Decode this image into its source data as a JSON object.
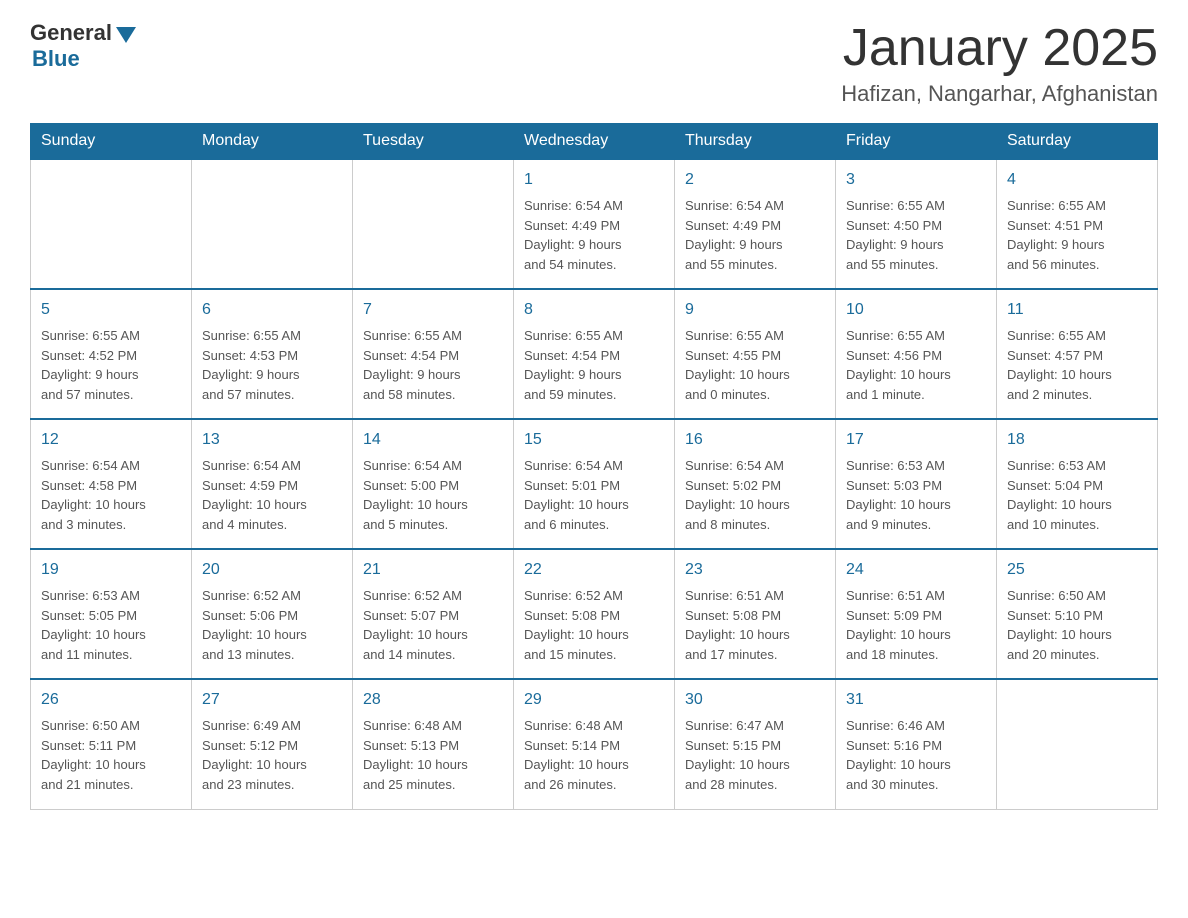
{
  "header": {
    "logo_general": "General",
    "logo_blue": "Blue",
    "month_title": "January 2025",
    "location": "Hafizan, Nangarhar, Afghanistan"
  },
  "weekdays": [
    "Sunday",
    "Monday",
    "Tuesday",
    "Wednesday",
    "Thursday",
    "Friday",
    "Saturday"
  ],
  "weeks": [
    [
      {
        "day": "",
        "info": ""
      },
      {
        "day": "",
        "info": ""
      },
      {
        "day": "",
        "info": ""
      },
      {
        "day": "1",
        "info": "Sunrise: 6:54 AM\nSunset: 4:49 PM\nDaylight: 9 hours\nand 54 minutes."
      },
      {
        "day": "2",
        "info": "Sunrise: 6:54 AM\nSunset: 4:49 PM\nDaylight: 9 hours\nand 55 minutes."
      },
      {
        "day": "3",
        "info": "Sunrise: 6:55 AM\nSunset: 4:50 PM\nDaylight: 9 hours\nand 55 minutes."
      },
      {
        "day": "4",
        "info": "Sunrise: 6:55 AM\nSunset: 4:51 PM\nDaylight: 9 hours\nand 56 minutes."
      }
    ],
    [
      {
        "day": "5",
        "info": "Sunrise: 6:55 AM\nSunset: 4:52 PM\nDaylight: 9 hours\nand 57 minutes."
      },
      {
        "day": "6",
        "info": "Sunrise: 6:55 AM\nSunset: 4:53 PM\nDaylight: 9 hours\nand 57 minutes."
      },
      {
        "day": "7",
        "info": "Sunrise: 6:55 AM\nSunset: 4:54 PM\nDaylight: 9 hours\nand 58 minutes."
      },
      {
        "day": "8",
        "info": "Sunrise: 6:55 AM\nSunset: 4:54 PM\nDaylight: 9 hours\nand 59 minutes."
      },
      {
        "day": "9",
        "info": "Sunrise: 6:55 AM\nSunset: 4:55 PM\nDaylight: 10 hours\nand 0 minutes."
      },
      {
        "day": "10",
        "info": "Sunrise: 6:55 AM\nSunset: 4:56 PM\nDaylight: 10 hours\nand 1 minute."
      },
      {
        "day": "11",
        "info": "Sunrise: 6:55 AM\nSunset: 4:57 PM\nDaylight: 10 hours\nand 2 minutes."
      }
    ],
    [
      {
        "day": "12",
        "info": "Sunrise: 6:54 AM\nSunset: 4:58 PM\nDaylight: 10 hours\nand 3 minutes."
      },
      {
        "day": "13",
        "info": "Sunrise: 6:54 AM\nSunset: 4:59 PM\nDaylight: 10 hours\nand 4 minutes."
      },
      {
        "day": "14",
        "info": "Sunrise: 6:54 AM\nSunset: 5:00 PM\nDaylight: 10 hours\nand 5 minutes."
      },
      {
        "day": "15",
        "info": "Sunrise: 6:54 AM\nSunset: 5:01 PM\nDaylight: 10 hours\nand 6 minutes."
      },
      {
        "day": "16",
        "info": "Sunrise: 6:54 AM\nSunset: 5:02 PM\nDaylight: 10 hours\nand 8 minutes."
      },
      {
        "day": "17",
        "info": "Sunrise: 6:53 AM\nSunset: 5:03 PM\nDaylight: 10 hours\nand 9 minutes."
      },
      {
        "day": "18",
        "info": "Sunrise: 6:53 AM\nSunset: 5:04 PM\nDaylight: 10 hours\nand 10 minutes."
      }
    ],
    [
      {
        "day": "19",
        "info": "Sunrise: 6:53 AM\nSunset: 5:05 PM\nDaylight: 10 hours\nand 11 minutes."
      },
      {
        "day": "20",
        "info": "Sunrise: 6:52 AM\nSunset: 5:06 PM\nDaylight: 10 hours\nand 13 minutes."
      },
      {
        "day": "21",
        "info": "Sunrise: 6:52 AM\nSunset: 5:07 PM\nDaylight: 10 hours\nand 14 minutes."
      },
      {
        "day": "22",
        "info": "Sunrise: 6:52 AM\nSunset: 5:08 PM\nDaylight: 10 hours\nand 15 minutes."
      },
      {
        "day": "23",
        "info": "Sunrise: 6:51 AM\nSunset: 5:08 PM\nDaylight: 10 hours\nand 17 minutes."
      },
      {
        "day": "24",
        "info": "Sunrise: 6:51 AM\nSunset: 5:09 PM\nDaylight: 10 hours\nand 18 minutes."
      },
      {
        "day": "25",
        "info": "Sunrise: 6:50 AM\nSunset: 5:10 PM\nDaylight: 10 hours\nand 20 minutes."
      }
    ],
    [
      {
        "day": "26",
        "info": "Sunrise: 6:50 AM\nSunset: 5:11 PM\nDaylight: 10 hours\nand 21 minutes."
      },
      {
        "day": "27",
        "info": "Sunrise: 6:49 AM\nSunset: 5:12 PM\nDaylight: 10 hours\nand 23 minutes."
      },
      {
        "day": "28",
        "info": "Sunrise: 6:48 AM\nSunset: 5:13 PM\nDaylight: 10 hours\nand 25 minutes."
      },
      {
        "day": "29",
        "info": "Sunrise: 6:48 AM\nSunset: 5:14 PM\nDaylight: 10 hours\nand 26 minutes."
      },
      {
        "day": "30",
        "info": "Sunrise: 6:47 AM\nSunset: 5:15 PM\nDaylight: 10 hours\nand 28 minutes."
      },
      {
        "day": "31",
        "info": "Sunrise: 6:46 AM\nSunset: 5:16 PM\nDaylight: 10 hours\nand 30 minutes."
      },
      {
        "day": "",
        "info": ""
      }
    ]
  ]
}
